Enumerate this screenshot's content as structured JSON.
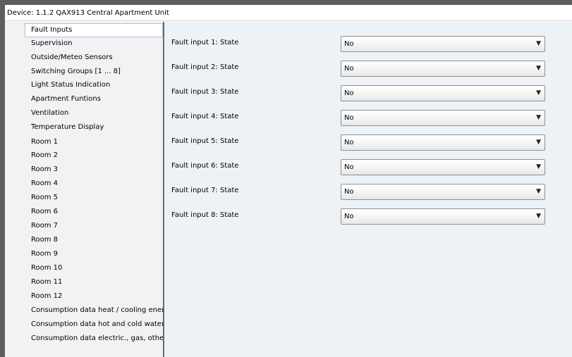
{
  "title_bar": {
    "text": "Device: 1.1.2  QAX913 Central Apartment Unit"
  },
  "sidebar": {
    "items": [
      {
        "label": "Fault Inputs"
      },
      {
        "label": "Supervision"
      },
      {
        "label": "Outside/Meteo Sensors"
      },
      {
        "label": "Switching Groups [1 ... 8]"
      },
      {
        "label": "Light Status Indication"
      },
      {
        "label": "Apartment Funtions"
      },
      {
        "label": "Ventilation"
      },
      {
        "label": "Temperature Display"
      },
      {
        "label": "Room 1"
      },
      {
        "label": "Room 2"
      },
      {
        "label": "Room 3"
      },
      {
        "label": "Room 4"
      },
      {
        "label": "Room 5"
      },
      {
        "label": "Room 6"
      },
      {
        "label": "Room 7"
      },
      {
        "label": "Room 8"
      },
      {
        "label": "Room 9"
      },
      {
        "label": "Room 10"
      },
      {
        "label": "Room 11"
      },
      {
        "label": "Room 12"
      },
      {
        "label": "Consumption data heat / cooling energy"
      },
      {
        "label": "Consumption data hot and cold water"
      },
      {
        "label": "Consumption data electric., gas, other"
      }
    ],
    "selected": "Fault Inputs"
  },
  "params": [
    {
      "label": "Fault input 1: State",
      "value": "No"
    },
    {
      "label": "Fault input 2: State",
      "value": "No"
    },
    {
      "label": "Fault input 3: State",
      "value": "No"
    },
    {
      "label": "Fault input 4: State",
      "value": "No"
    },
    {
      "label": "Fault input 5: State",
      "value": "No"
    },
    {
      "label": "Fault input 6: State",
      "value": "No"
    },
    {
      "label": "Fault input 7: State",
      "value": "No"
    },
    {
      "label": "Fault input 8: State",
      "value": "No"
    }
  ],
  "icons": {
    "dropdown_arrow": "dropdown-arrow-icon"
  },
  "colors": {
    "content_background": "#edf2f7",
    "sidebar_background": "#f2f2f2",
    "selection_border": "#9ec3e6",
    "window_frame": "#5e5e5e"
  }
}
